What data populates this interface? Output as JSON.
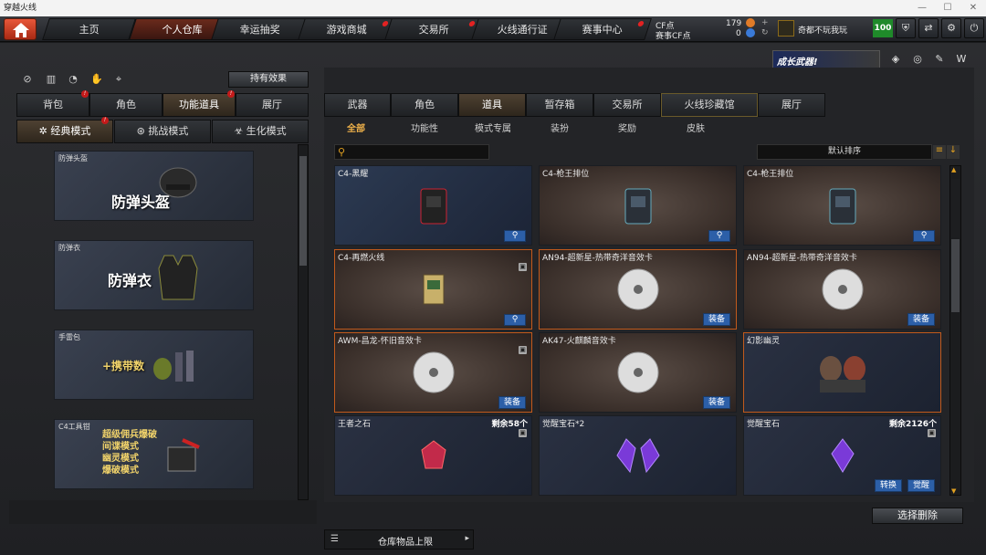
{
  "window": {
    "title": "穿越火线"
  },
  "topnav": {
    "tabs": [
      "主页",
      "个人仓库",
      "幸运抽奖",
      "游戏商城",
      "交易所",
      "火线通行证",
      "赛事中心"
    ]
  },
  "currency": {
    "cf_label": "CF点",
    "cf_value": "179",
    "match_cf_label": "赛事CF点",
    "match_cf_value": "0"
  },
  "user": {
    "name": "奇都不玩我玩",
    "level": "100"
  },
  "banner": {
    "text": "成长武器!"
  },
  "left": {
    "effects_button": "持有效果",
    "tabs": [
      "背包",
      "角色",
      "功能道具",
      "展厅"
    ],
    "modes": [
      "经典模式",
      "挑战模式",
      "生化模式"
    ],
    "cards": [
      {
        "label": "防弹头盔",
        "big": "防弹头盔"
      },
      {
        "label": "防弹衣",
        "big": "防弹衣"
      },
      {
        "label": "手雷包",
        "big": "+携带数"
      },
      {
        "label": "C4工具钳",
        "lines": [
          "超级佣兵爆破",
          "间谍模式",
          "幽灵模式",
          "爆破模式"
        ]
      }
    ],
    "storage_limit": "仓库物品上限"
  },
  "right": {
    "tabs": [
      "武器",
      "角色",
      "道具",
      "暂存箱",
      "交易所",
      "火线珍藏馆",
      "展厅"
    ],
    "subtabs": [
      "全部",
      "功能性",
      "模式专属",
      "装扮",
      "奖励",
      "皮肤"
    ],
    "search_placeholder": "",
    "sort_label": "默认排序",
    "delete_button": "选择删除",
    "items": [
      {
        "name": "C4-黑耀",
        "count": "",
        "actions": [
          "search"
        ]
      },
      {
        "name": "C4-枪王排位",
        "count": "",
        "actions": [
          "search"
        ]
      },
      {
        "name": "C4-枪王排位",
        "count": "",
        "actions": [
          "search"
        ]
      },
      {
        "name": "C4-再燃火线",
        "count": "",
        "actions": [
          "search"
        ]
      },
      {
        "name": "AN94-超新星-热带奇洋音效卡",
        "count": "",
        "actions": [
          "装备"
        ]
      },
      {
        "name": "AN94-超新星-热带奇洋音效卡",
        "count": "",
        "actions": [
          "装备"
        ]
      },
      {
        "name": "AWM-昌龙-怀旧音效卡",
        "count": "",
        "actions": [
          "装备"
        ]
      },
      {
        "name": "AK47-火麒麟音效卡",
        "count": "",
        "actions": [
          "装备"
        ]
      },
      {
        "name": "幻影幽灵",
        "count": "",
        "actions": []
      },
      {
        "name": "王者之石",
        "count": "剩余58个",
        "actions": []
      },
      {
        "name": "觉醒宝石*2",
        "count": "",
        "actions": []
      },
      {
        "name": "觉醒宝石",
        "count": "剩余2126个",
        "actions": [
          "转换",
          "觉醒"
        ]
      }
    ]
  }
}
